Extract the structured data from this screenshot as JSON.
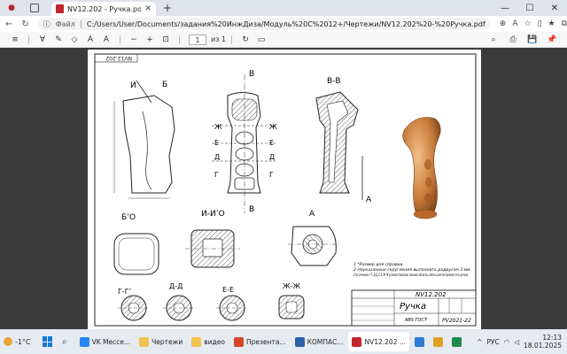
{
  "browser": {
    "tab_title": "NV12.202 - Ручка.pdf",
    "file_label": "Файл",
    "url": "C:/Users/User/Documents/задания%20ИнжДиза/Модуль%20C%2012+/Чертежи/NV12.202%20-%20Ручка.pdf"
  },
  "pdf_toolbar": {
    "page_current": "1",
    "page_of": "из 1"
  },
  "drawing": {
    "corner_stamp": "NV12.202",
    "section_labels": {
      "B": "В",
      "I": "И",
      "BI": "Б",
      "VV": "В-В",
      "BO": "Б’О",
      "IIO": "И-И’О",
      "A": "А",
      "GG": "Г-Г’",
      "DD": "Д-Д",
      "EE": "Е-Е",
      "ZhZh": "Ж-Ж",
      "Zh": "Ж",
      "D": "Д",
      "E": "Е",
      "G": "Г"
    },
    "notes": [
      "1 *Размер для справки.",
      "2 Неуказанные скругления выполнить радиусом 3 мм.",
      "3 На сечениях Г-Г, Д-Д, Е-Е, Ж-Ж условно показаны плоские объекты, взятые для построения тела детали."
    ],
    "title_block": {
      "code": "NV12.202",
      "name": "Ручка",
      "material": "ABS ГОСТ",
      "org": "PV2021-22"
    }
  },
  "taskbar": {
    "weather_temp": "-1°C",
    "items": [
      {
        "label": "VK Мессе...",
        "color": "#2787f5"
      },
      {
        "label": "Чертежи",
        "color": "#f2c14e"
      },
      {
        "label": "видео",
        "color": "#f2c14e"
      },
      {
        "label": "Презента...",
        "color": "#d24726"
      },
      {
        "label": "КОМПАС...",
        "color": "#2e5fa8"
      },
      {
        "label": "NV12.202 ...",
        "color": "#c0262d"
      },
      {
        "label": "",
        "color": "#2b7bd6"
      },
      {
        "label": "",
        "color": "#e0a020"
      },
      {
        "label": "",
        "color": "#1f8a4c"
      }
    ],
    "lang": "РУС",
    "time": "12:13",
    "date": "18.01.2025"
  }
}
